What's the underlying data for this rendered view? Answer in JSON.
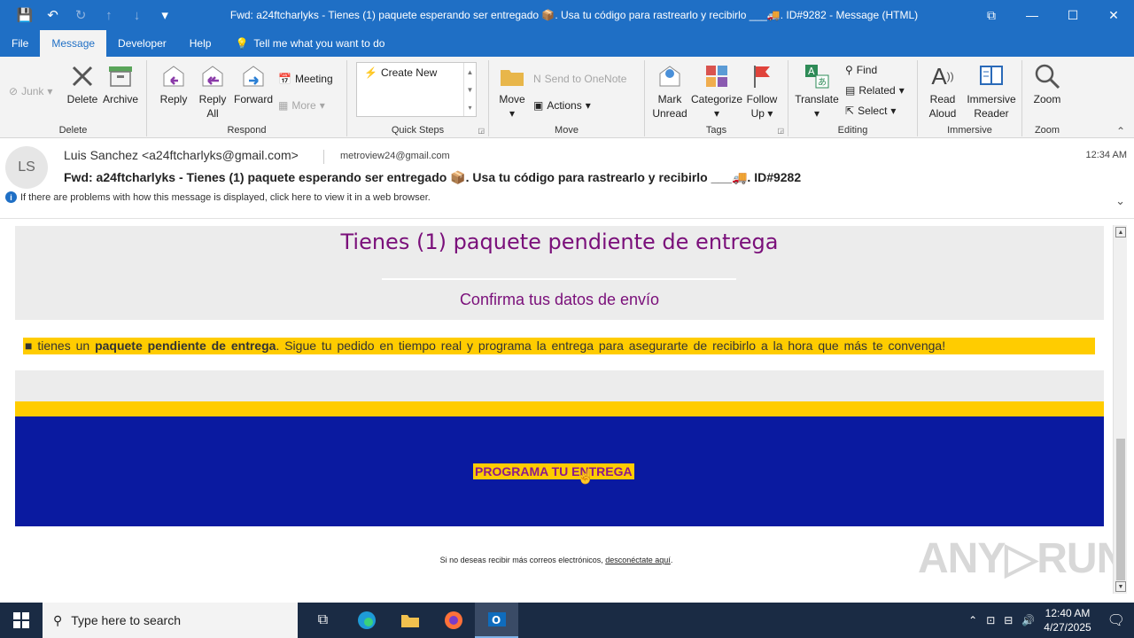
{
  "window": {
    "title": "Fwd: a24ftcharlyks - Tienes (1) paquete esperando ser entregado 📦. Usa tu código para rastrearlo y recibirlo ___🚚. ID#9282  -  Message (HTML)",
    "controls": {
      "restore_ribbon": "⧉",
      "minimize": "—",
      "maximize": "☐",
      "close": "✕"
    }
  },
  "menu": {
    "items": [
      "File",
      "Message",
      "Developer",
      "Help"
    ],
    "active": "Message",
    "tell_me": "Tell me what you want to do"
  },
  "ribbon": {
    "delete_group": {
      "label": "Delete",
      "junk": "Junk",
      "delete": "Delete",
      "archive": "Archive"
    },
    "respond_group": {
      "label": "Respond",
      "reply": "Reply",
      "reply_all_line1": "Reply",
      "reply_all_line2": "All",
      "forward": "Forward",
      "meeting": "Meeting",
      "more": "More"
    },
    "quick_steps_group": {
      "label": "Quick Steps",
      "create_new": "Create New"
    },
    "move_group": {
      "label": "Move",
      "move": "Move",
      "onenote": "Send to OneNote",
      "actions": "Actions"
    },
    "tags_group": {
      "label": "Tags",
      "mark_unread_line1": "Mark",
      "mark_unread_line2": "Unread",
      "categorize": "Categorize",
      "follow_up_line1": "Follow",
      "follow_up_line2": "Up"
    },
    "editing_group": {
      "label": "Editing",
      "translate": "Translate",
      "find": "Find",
      "related": "Related",
      "select": "Select"
    },
    "immersive_group": {
      "label": "Immersive",
      "read_aloud_line1": "Read",
      "read_aloud_line2": "Aloud",
      "immersive_reader_line1": "Immersive",
      "immersive_reader_line2": "Reader"
    },
    "zoom_group": {
      "label": "Zoom",
      "zoom": "Zoom"
    }
  },
  "message": {
    "avatar_initials": "LS",
    "from": "Luis Sanchez <a24ftcharlyks@gmail.com>",
    "to": "metroview24@gmail.com",
    "time": "12:34 AM",
    "subject": "Fwd: a24ftcharlyks - Tienes (1) paquete esperando ser entregado 📦. Usa tu código para rastrearlo y recibirlo ___🚚. ID#9282",
    "info": "If there are problems with how this message is displayed, click here to view it in a web browser."
  },
  "email": {
    "heading": "Tienes (1) paquete pendiente de entrega",
    "subheading": "Confirma tus datos de envío",
    "notice_prefix": "■ tienes un ",
    "notice_bold": "paquete pendiente de entrega",
    "notice_suffix": ". Sigue tu pedido en tiempo real y programa la entrega para asegurarte de recibirlo a la hora que más te convenga!",
    "cta": "PROGRAMA TU ENTREGA",
    "footer_text": "Si no deseas recibir más correos electrónicos, ",
    "footer_link": "desconéctate aquí",
    "footer_end": "."
  },
  "watermark": "ANY▷RUN",
  "taskbar": {
    "search_placeholder": "Type here to search",
    "time": "12:40 AM",
    "date": "4/27/2025"
  },
  "colors": {
    "accent": "#1f6fc5",
    "email_purple": "#7a0f7a",
    "email_yellow": "#ffcc00",
    "email_blue": "#0a1aa0"
  }
}
